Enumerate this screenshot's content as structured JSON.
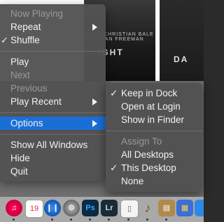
{
  "main_menu": {
    "now_playing": "Now Playing",
    "repeat": "Repeat",
    "shuffle": "Shuffle",
    "shuffle_check": "✓",
    "play": "Play",
    "next": "Next",
    "previous": "Previous",
    "play_recent": "Play Recent",
    "options": "Options",
    "show_all_windows": "Show All Windows",
    "hide": "Hide",
    "quit": "Quit"
  },
  "options_submenu": {
    "keep_in_dock": "Keep in Dock",
    "keep_in_dock_check": "✓",
    "open_at_login": "Open at Login",
    "show_in_finder": "Show in Finder",
    "assign_to": "Assign To",
    "all_desktops": "All Desktops",
    "this_desktop": "This Desktop",
    "this_desktop_check": "✓",
    "none": "None"
  },
  "background": {
    "poster1_credit": "ZZLE  CHRISTIAN BALE  MORGAN FREEMAN",
    "poster1_title": "IGHT",
    "poster2_title": "DA"
  },
  "dock": {
    "calendar_day": "19",
    "photoshop": "Ps",
    "lightroom": "Lr"
  },
  "colors": {
    "menu_bg": "#525252",
    "highlight": "#1a6fd6",
    "dock_bg": "#a9a9a9"
  }
}
